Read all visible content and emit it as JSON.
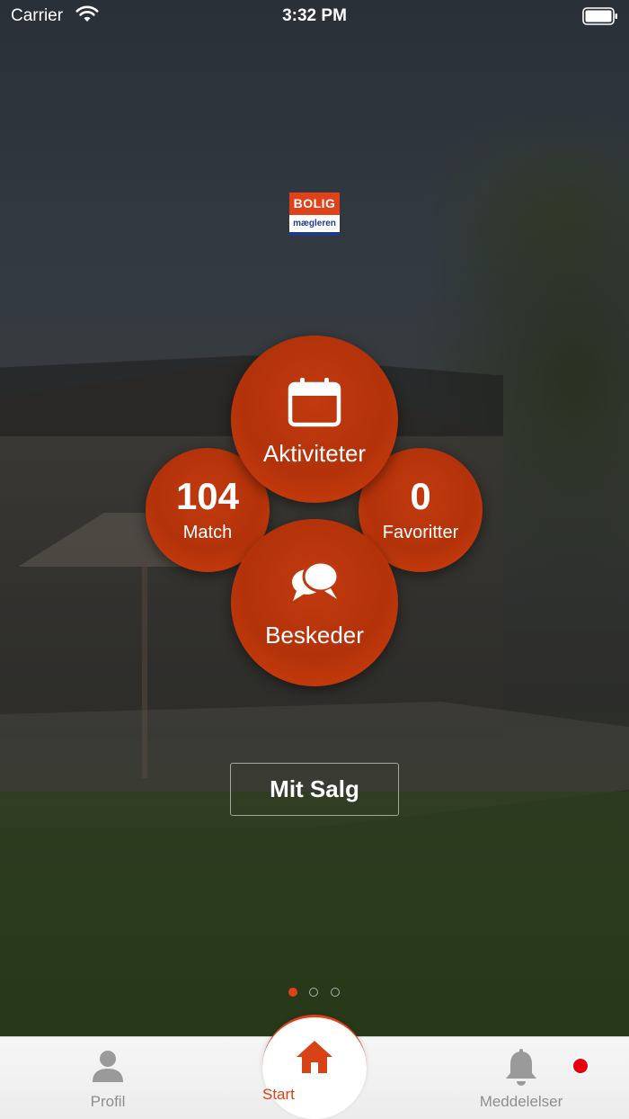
{
  "status_bar": {
    "carrier": "Carrier",
    "time": "3:32 PM"
  },
  "logo": {
    "top": "BOLIG",
    "bottom": "mægleren"
  },
  "tiles": {
    "match": {
      "count": "104",
      "label": "Match"
    },
    "favoritter": {
      "count": "0",
      "label": "Favoritter"
    },
    "aktiviteter": {
      "label": "Aktiviteter",
      "icon": "calendar-icon"
    },
    "beskeder": {
      "label": "Beskeder",
      "icon": "chat-bubbles-icon"
    }
  },
  "mit_salg_label": "Mit Salg",
  "pager": {
    "pages": 3,
    "current": 1
  },
  "tabbar": {
    "profil": {
      "label": "Profil",
      "icon": "person-icon"
    },
    "start": {
      "label": "Start",
      "icon": "home-icon"
    },
    "meddelelser": {
      "label": "Meddelelser",
      "icon": "bell-icon",
      "has_badge": true
    }
  },
  "colors": {
    "accent": "#e0411a",
    "circle": "#b3320a",
    "badge": "#e8000b"
  }
}
